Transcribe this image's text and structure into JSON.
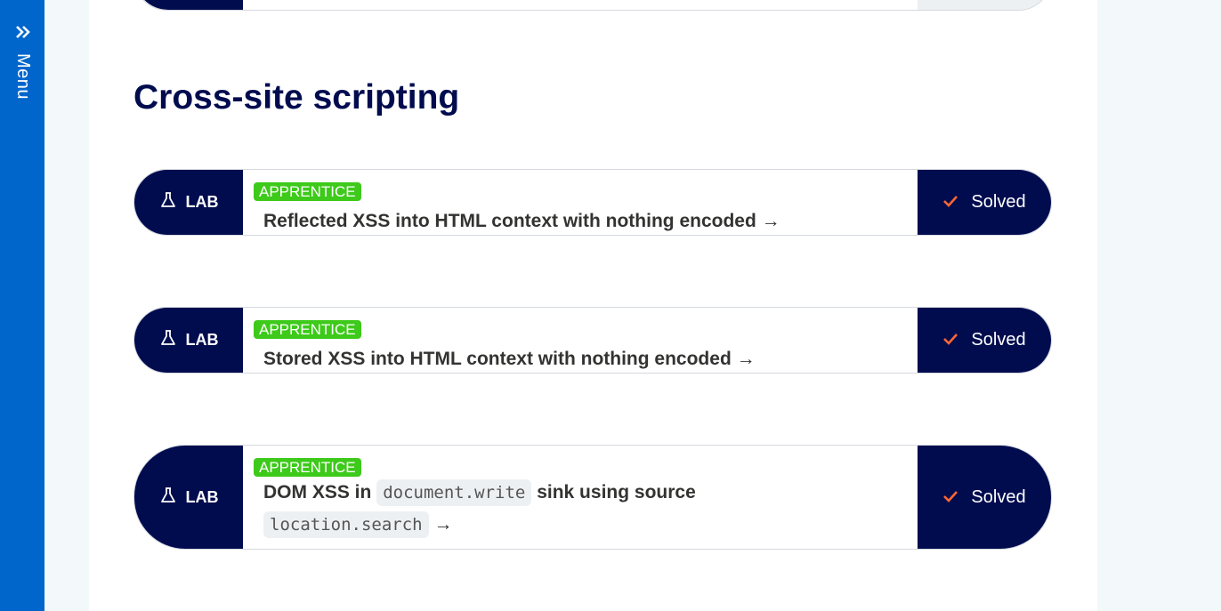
{
  "sidebar": {
    "menu_label": "Menu",
    "icon": "double-chevron-right-icon"
  },
  "section": {
    "title": "Cross-site scripting"
  },
  "labs": [
    {
      "badge": "LAB",
      "level": "APPRENTICE",
      "title_parts": [
        "Reflected XSS into HTML context with nothing encoded"
      ],
      "status": "Solved"
    },
    {
      "badge": "LAB",
      "level": "APPRENTICE",
      "title_parts": [
        "Stored XSS into HTML context with nothing encoded"
      ],
      "status": "Solved"
    },
    {
      "badge": "LAB",
      "level": "APPRENTICE",
      "title_before": "DOM XSS in",
      "code1": "document.write",
      "title_middle": "sink using source",
      "code2": "location.search",
      "status": "Solved"
    }
  ],
  "colors": {
    "sidebar": "#0066cc",
    "navy": "#010c4f",
    "level_green": "#3dca1a",
    "check_orange": "#ff6633"
  }
}
